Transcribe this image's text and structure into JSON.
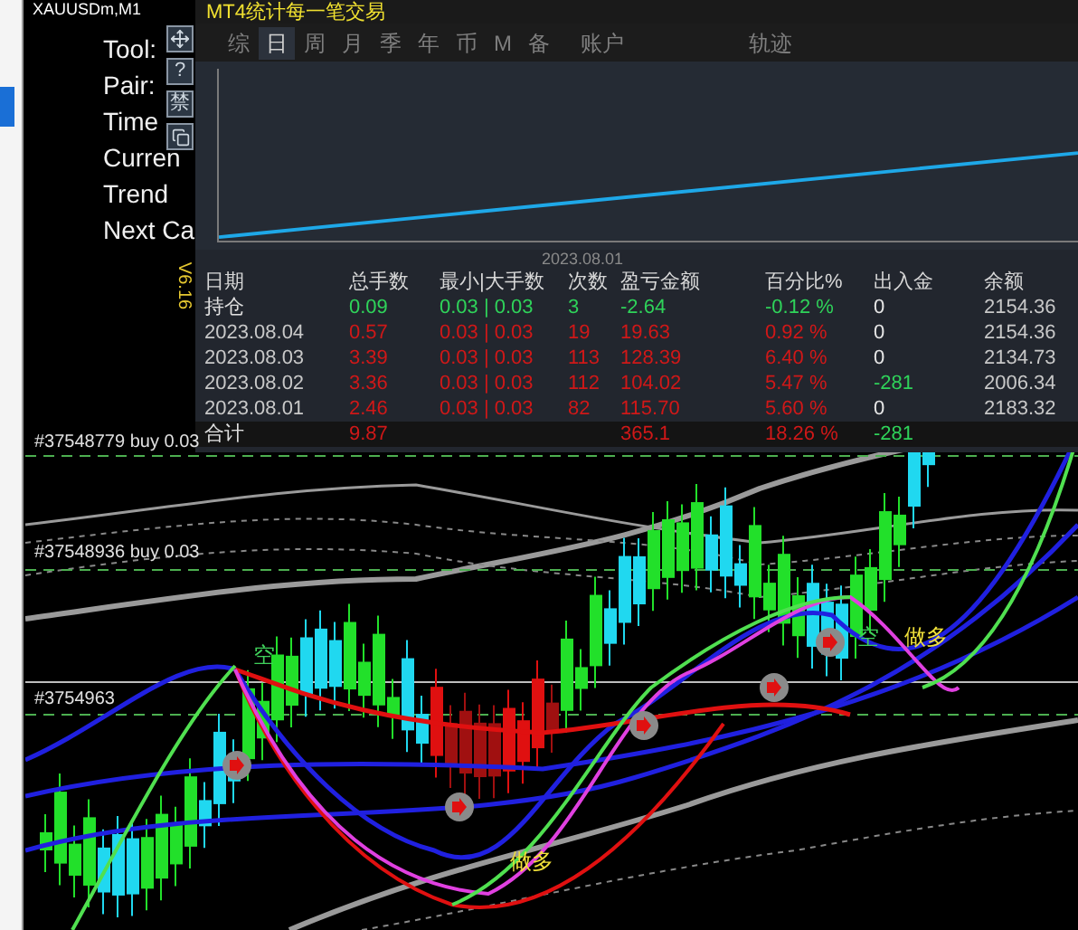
{
  "symbol_label": "XAUUSDm,M1",
  "info_lines": [
    "Tool:",
    "Pair:",
    "Time",
    "Curren",
    "Trend",
    "Next Ca"
  ],
  "side_buttons": [
    {
      "kind": "move"
    },
    {
      "kind": "text",
      "text": "?"
    },
    {
      "kind": "text",
      "text": "禁"
    },
    {
      "kind": "copy"
    }
  ],
  "orders": [
    "#37548779 buy 0.03",
    "#37548936 buy 0.03",
    "#3754963"
  ],
  "signals": [
    {
      "text": "空",
      "kind": "short"
    },
    {
      "text": "空",
      "kind": "short"
    },
    {
      "text": "做多",
      "kind": "long"
    },
    {
      "text": "做多",
      "kind": "long"
    }
  ],
  "panel": {
    "title": "MT4统计每一笔交易",
    "version": "V6.16",
    "tabs": [
      {
        "label": "综",
        "selected": false
      },
      {
        "label": "日",
        "selected": true
      },
      {
        "label": "周",
        "selected": false
      },
      {
        "label": "月",
        "selected": false
      },
      {
        "label": "季",
        "selected": false
      },
      {
        "label": "年",
        "selected": false
      },
      {
        "label": "币",
        "selected": false
      },
      {
        "label": "M",
        "selected": false
      },
      {
        "label": "备",
        "selected": false
      },
      {
        "label": "账户",
        "selected": false
      },
      {
        "label": "轨迹",
        "selected": false
      }
    ],
    "equity_chart": {
      "date_label": "2023.08.01"
    },
    "table": {
      "columns": [
        "日期",
        "总手数",
        "最小|大手数",
        "次数",
        "盈亏金额",
        "百分比%",
        "出入金",
        "余额"
      ],
      "rows": [
        {
          "kind": "holding",
          "date": "持仓",
          "lots": "0.09",
          "min_max": "0.03 | 0.03",
          "count": "3",
          "pnl": "-2.64",
          "percent": "-0.12 %",
          "flow": {
            "text": "0",
            "color": "#e6e6e6"
          },
          "balance": "2154.36"
        },
        {
          "kind": "day",
          "date": "2023.08.04",
          "lots": "0.57",
          "min_max": "0.03 | 0.03",
          "count": "19",
          "pnl": "19.63",
          "percent": "0.92 %",
          "flow": {
            "text": "0",
            "color": "#e6e6e6"
          },
          "balance": "2154.36"
        },
        {
          "kind": "day",
          "date": "2023.08.03",
          "lots": "3.39",
          "min_max": "0.03 | 0.03",
          "count": "113",
          "pnl": "128.39",
          "percent": "6.40 %",
          "flow": {
            "text": "0",
            "color": "#e6e6e6"
          },
          "balance": "2134.73"
        },
        {
          "kind": "day",
          "date": "2023.08.02",
          "lots": "3.36",
          "min_max": "0.03 | 0.03",
          "count": "112",
          "pnl": "104.02",
          "percent": "5.47 %",
          "flow": {
            "text": "-281",
            "color": "#2fd35a"
          },
          "balance": "2006.34"
        },
        {
          "kind": "day",
          "date": "2023.08.01",
          "lots": "2.46",
          "min_max": "0.03 | 0.03",
          "count": "82",
          "pnl": "115.70",
          "percent": "5.60 %",
          "flow": {
            "text": "0",
            "color": "#e6e6e6"
          },
          "balance": "2183.32"
        },
        {
          "kind": "total",
          "date": "合计",
          "lots": "9.87",
          "pnl": "365.1",
          "percent": "18.26 %",
          "flow": {
            "text": "-281",
            "color": "#2fd35a"
          }
        }
      ]
    }
  }
}
